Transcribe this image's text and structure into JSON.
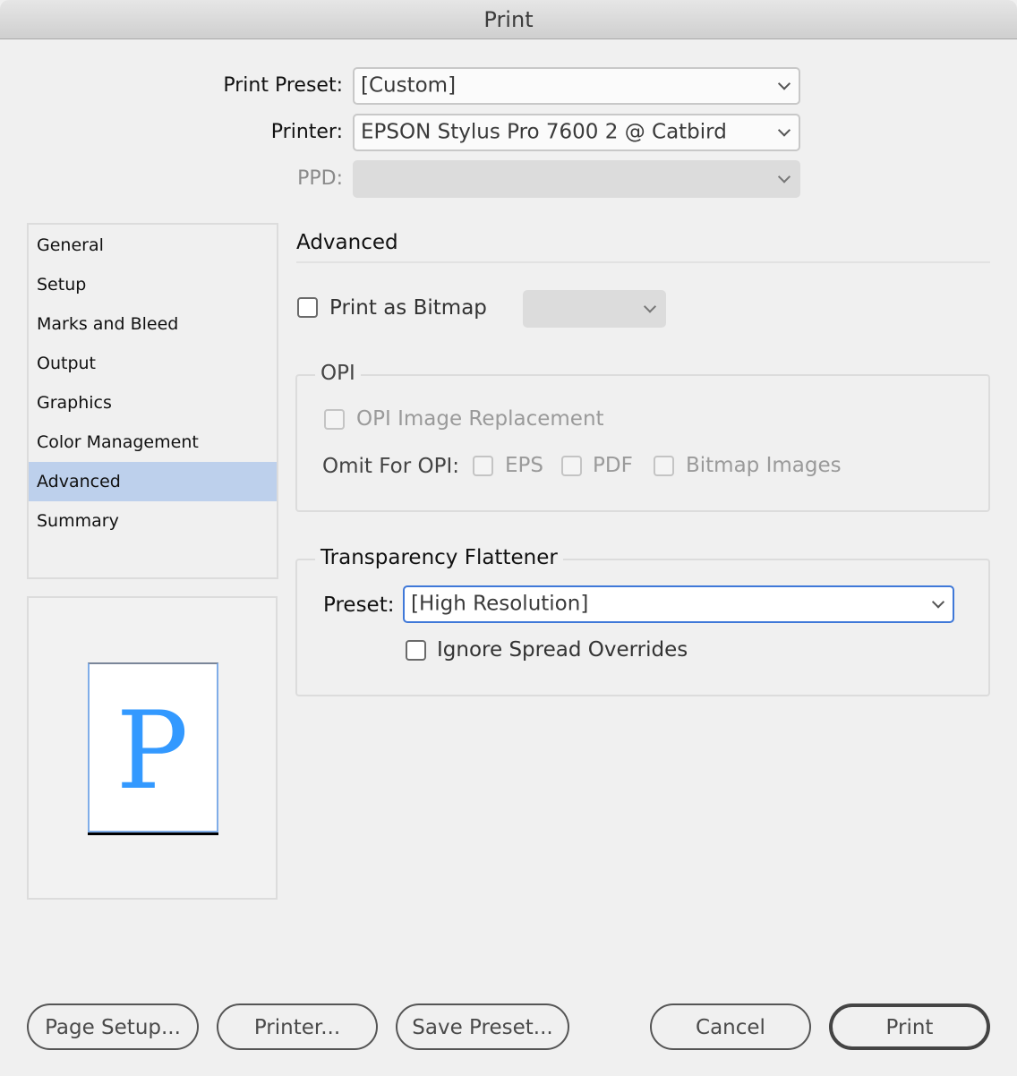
{
  "window": {
    "title": "Print"
  },
  "header": {
    "print_preset": {
      "label": "Print Preset:",
      "value": "[Custom]"
    },
    "printer": {
      "label": "Printer:",
      "value": "EPSON Stylus Pro 7600 2 @ Catbird"
    },
    "ppd": {
      "label": "PPD:",
      "value": "",
      "disabled": true
    }
  },
  "sidebar": {
    "items": [
      {
        "label": "General"
      },
      {
        "label": "Setup"
      },
      {
        "label": "Marks and Bleed"
      },
      {
        "label": "Output"
      },
      {
        "label": "Graphics"
      },
      {
        "label": "Color Management"
      },
      {
        "label": "Advanced",
        "selected": true
      },
      {
        "label": "Summary"
      }
    ]
  },
  "preview": {
    "glyph": "P",
    "glyph_color": "#3399ff"
  },
  "advanced": {
    "title": "Advanced",
    "print_as_bitmap": {
      "label": "Print as Bitmap",
      "checked": false,
      "resolution_value": ""
    },
    "opi": {
      "title": "OPI",
      "image_replacement": {
        "label": "OPI Image Replacement",
        "checked": false,
        "disabled": true
      },
      "omit_label": "Omit For OPI:",
      "omit_options": [
        {
          "label": "EPS",
          "checked": false
        },
        {
          "label": "PDF",
          "checked": false
        },
        {
          "label": "Bitmap Images",
          "checked": false
        }
      ]
    },
    "transparency": {
      "title": "Transparency Flattener",
      "preset_label": "Preset:",
      "preset_value": "[High Resolution]",
      "ignore_overrides": {
        "label": "Ignore Spread Overrides",
        "checked": false
      }
    }
  },
  "buttons": {
    "page_setup": "Page Setup...",
    "printer": "Printer...",
    "save_preset": "Save Preset...",
    "cancel": "Cancel",
    "print": "Print"
  },
  "colors": {
    "accent_focus": "#3f78d8",
    "selection": "#bdd0ec"
  }
}
